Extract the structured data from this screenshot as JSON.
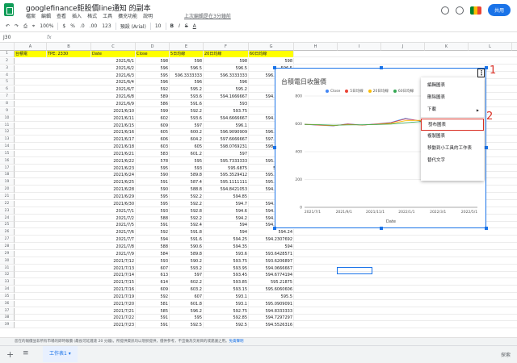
{
  "title": {
    "doc": "googlefinance鉅股價line通知 的副本",
    "last_edit": "上次編輯是在3分鐘前",
    "share": "共用"
  },
  "menu_items": [
    "檔案",
    "編輯",
    "查看",
    "插入",
    "格式",
    "工具",
    "擴充功能",
    "說明"
  ],
  "toolbar": {
    "zoom": "100%",
    "currency": "$",
    "percent": "%",
    "dec1": ".0",
    "dec2": ".00",
    "format": "123",
    "font": "預設 (Arial)",
    "size": "10",
    "bold": "B",
    "italic": "I",
    "strike": "S",
    "color": "A"
  },
  "formula": {
    "cell": "J30",
    "fx": "fx"
  },
  "columns": [
    "A",
    "B",
    "C",
    "D",
    "E",
    "F",
    "G",
    "H",
    "I",
    "J",
    "K",
    "L",
    "M"
  ],
  "row1": {
    "a": "台積電",
    "b": "TPE: 2330",
    "c": "Date",
    "d": "Close",
    "e": "5日均線",
    "f": "20日均線",
    "g": "60日均線"
  },
  "rows": [
    [
      "2021/6/1",
      "598",
      "598",
      "598",
      "598"
    ],
    [
      "2021/6/2",
      "596",
      "596.5",
      "596.5",
      "596.5"
    ],
    [
      "2021/6/3",
      "595",
      "596.3333333",
      "596.3333333",
      "596.3333333"
    ],
    [
      "2021/6/4",
      "596",
      "596",
      "596",
      "596"
    ],
    [
      "2021/6/7",
      "592",
      "595.2",
      "595.2",
      "595.2"
    ],
    [
      "2021/6/8",
      "589",
      "593.6",
      "594.1666667",
      "594.1666667"
    ],
    [
      "2021/6/9",
      "586",
      "591.6",
      "593",
      "593"
    ],
    [
      "2021/6/10",
      "599",
      "592.2",
      "593.75",
      "593.75"
    ],
    [
      "2021/6/11",
      "602",
      "593.6",
      "594.6666667",
      "594.6666667"
    ],
    [
      "2021/6/15",
      "609",
      "597",
      "596.1",
      "596.1"
    ],
    [
      "2021/6/16",
      "605",
      "600.2",
      "596.9090909",
      "596.9090909"
    ],
    [
      "2021/6/17",
      "606",
      "604.2",
      "597.6666667",
      "597.6666667"
    ],
    [
      "2021/6/18",
      "603",
      "605",
      "598.0769231",
      "598.0769231"
    ],
    [
      "2021/6/21",
      "583",
      "601.2",
      "597",
      "597"
    ],
    [
      "2021/6/22",
      "578",
      "595",
      "595.7333333",
      "595.7333333"
    ],
    [
      "2021/6/23",
      "595",
      "593",
      "595.6875",
      "595.6875"
    ],
    [
      "2021/6/24",
      "590",
      "589.8",
      "595.3529412",
      "595.3529412"
    ],
    [
      "2021/6/25",
      "591",
      "587.4",
      "595.1111111",
      "595.1111111"
    ],
    [
      "2021/6/28",
      "590",
      "588.8",
      "594.8421053",
      "594.8421053"
    ],
    [
      "2021/6/29",
      "595",
      "592.2",
      "594.85",
      "594.85"
    ],
    [
      "2021/6/30",
      "595",
      "592.2",
      "594.7",
      "594.8571429"
    ],
    [
      "2021/7/1",
      "593",
      "592.8",
      "594.6",
      "594.7727273"
    ],
    [
      "2021/7/2",
      "588",
      "592.2",
      "594.2",
      "594.4782609"
    ],
    [
      "2021/7/5",
      "591",
      "592.4",
      "594",
      "594.3333333"
    ],
    [
      "2021/7/6",
      "592",
      "591.8",
      "594",
      "594.24"
    ],
    [
      "2021/7/7",
      "594",
      "591.6",
      "594.25",
      "594.2307692"
    ],
    [
      "2021/7/8",
      "588",
      "590.6",
      "594.35",
      "594"
    ],
    [
      "2021/7/9",
      "584",
      "589.8",
      "593.6",
      "593.6428571"
    ],
    [
      "2021/7/12",
      "593",
      "590.2",
      "593.75",
      "593.6206897"
    ],
    [
      "2021/7/13",
      "607",
      "593.2",
      "593.95",
      "594.0666667"
    ],
    [
      "2021/7/14",
      "613",
      "597",
      "593.45",
      "594.6774194"
    ],
    [
      "2021/7/15",
      "614",
      "602.2",
      "593.85",
      "595.21875"
    ],
    [
      "2021/7/16",
      "609",
      "603.2",
      "593.15",
      "595.6060606"
    ],
    [
      "2021/7/19",
      "592",
      "607",
      "593.1",
      "595.5"
    ],
    [
      "2021/7/20",
      "581",
      "601.8",
      "593.1",
      "595.0909091"
    ],
    [
      "2021/7/21",
      "585",
      "596.2",
      "592.75",
      "594.8333333"
    ],
    [
      "2021/7/22",
      "591",
      "595",
      "592.85",
      "594.7297297"
    ],
    [
      "2021/7/23",
      "591",
      "592.5",
      "592.5",
      "594.5526316"
    ]
  ],
  "chart": {
    "title": "台積電日收盤價",
    "x_label": "Date"
  },
  "chart_data": {
    "type": "line",
    "title": "台積電日收盤價",
    "xlabel": "Date",
    "ylabel": "",
    "ylim": [
      0,
      800
    ],
    "yticks": [
      0,
      200,
      400,
      600,
      800
    ],
    "x_ticks": [
      "2021/7/1",
      "2021/9/1",
      "2021/11/1",
      "2022/1/1",
      "2022/3/1",
      "2022/5/1"
    ],
    "x": [
      "2021/6",
      "2021/7",
      "2021/8",
      "2021/9",
      "2021/10",
      "2021/11",
      "2021/12",
      "2022/1",
      "2022/2",
      "2022/3",
      "2022/4",
      "2022/5",
      "2022/6"
    ],
    "series": [
      {
        "name": "Close",
        "color": "#4285f4",
        "values": [
          596,
          590,
          585,
          600,
          590,
          600,
          610,
          640,
          620,
          580,
          570,
          560,
          545
        ]
      },
      {
        "name": "5日均線",
        "color": "#ea4335",
        "values": [
          596,
          591,
          586,
          598,
          591,
          598,
          608,
          635,
          622,
          585,
          573,
          562,
          548
        ]
      },
      {
        "name": "20日均線",
        "color": "#fbbc04",
        "values": [
          596,
          593,
          588,
          594,
          592,
          596,
          603,
          622,
          625,
          598,
          580,
          566,
          555
        ]
      },
      {
        "name": "60日均線",
        "color": "#34a853",
        "values": [
          596,
          594,
          590,
          592,
          593,
          595,
          598,
          608,
          615,
          607,
          596,
          580,
          568
        ]
      }
    ]
  },
  "context_menu": {
    "items": [
      "編輯圖表",
      "刪除圖表",
      "下載",
      "發布圖表",
      "複製圖表",
      "移動到小工具的工作表",
      "替代文字"
    ]
  },
  "annotations": {
    "one": "1",
    "two": "2"
  },
  "notice": {
    "text": "您在的報價並非所有市場的即時報價 (最長可延遲達 20 分鐘)。所提供資訊均以現狀提供，僅供參考，不宜做為交易目的或建議之用。",
    "link": "免責聲明"
  },
  "sheetbar": {
    "add": "+",
    "all": "≡",
    "tab": "工作表1 ▾",
    "explore": "探索"
  }
}
